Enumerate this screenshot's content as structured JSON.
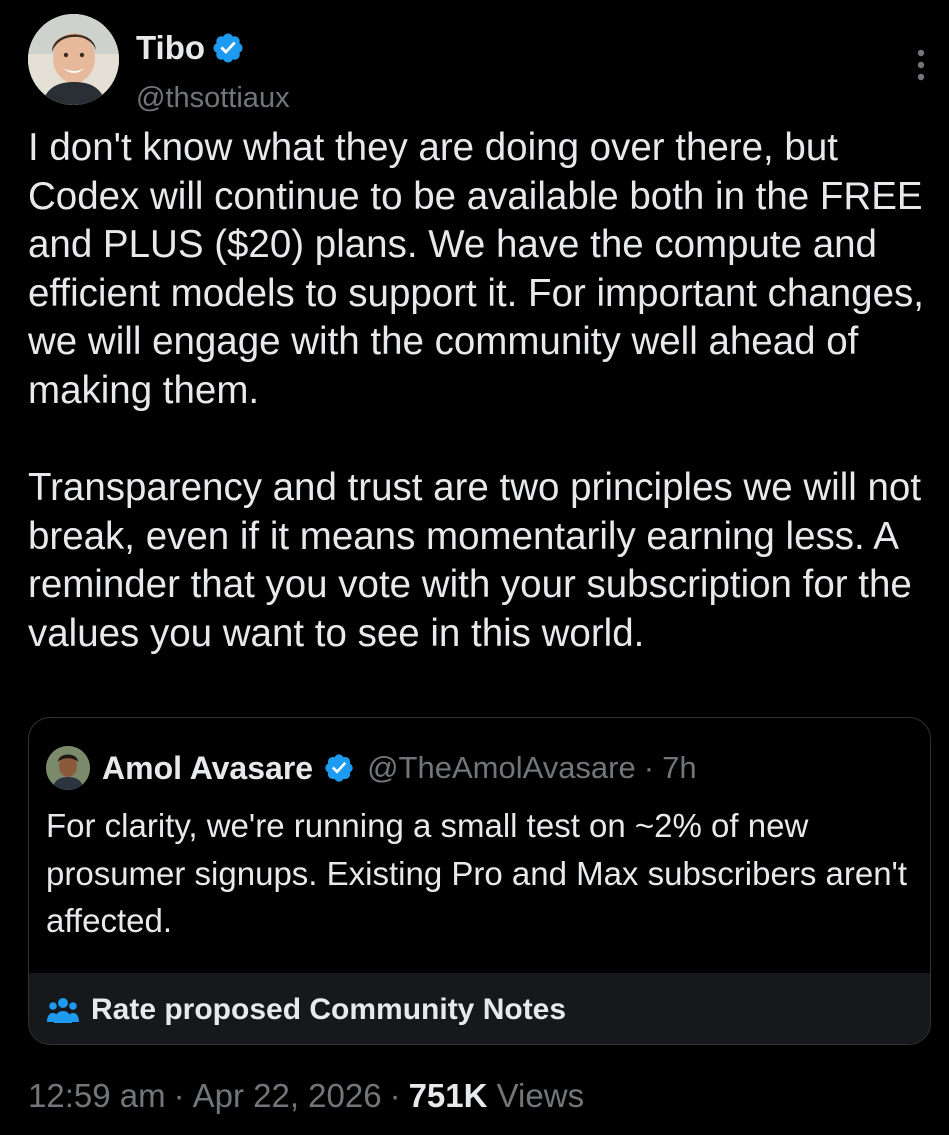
{
  "author": {
    "name": "Tibo",
    "handle": "@thsottiaux",
    "avatar_icon": "person-photo-avatar",
    "verified_icon": "verified-badge-icon",
    "verified_color": "#1d9bf0"
  },
  "tweet": {
    "paragraphs": [
      "I don't know what they are doing over there, but Codex will continue to be available both in the FREE and PLUS ($20) plans. We have the compute and efficient models to support it. For important changes, we will engage with the community well ahead of making them.",
      "Transparency and trust are two principles we will not break, even if it means momentarily earning less. A reminder that you vote with your subscription for the values you want to see in this world."
    ],
    "more_icon": "more-options-icon"
  },
  "quote": {
    "name": "Amol Avasare",
    "handle": "@TheAmolAvasare",
    "separator": "·",
    "time": "7h",
    "text": "For clarity, we're running a small test on ~2% of new prosumer signups. Existing Pro and Max subscribers aren't affected.",
    "notes_icon": "people-icon",
    "notes_label": "Rate proposed Community Notes"
  },
  "meta": {
    "time": "12:59 am",
    "separator": "·",
    "date": "Apr 22, 2026",
    "views_count": "751K",
    "views_label": "Views"
  },
  "colors": {
    "background": "#000000",
    "text_primary": "#e7e9ea",
    "text_secondary": "#71767b",
    "accent": "#1d9bf0",
    "border": "#2f3336",
    "notes_bar": "#16181c"
  }
}
